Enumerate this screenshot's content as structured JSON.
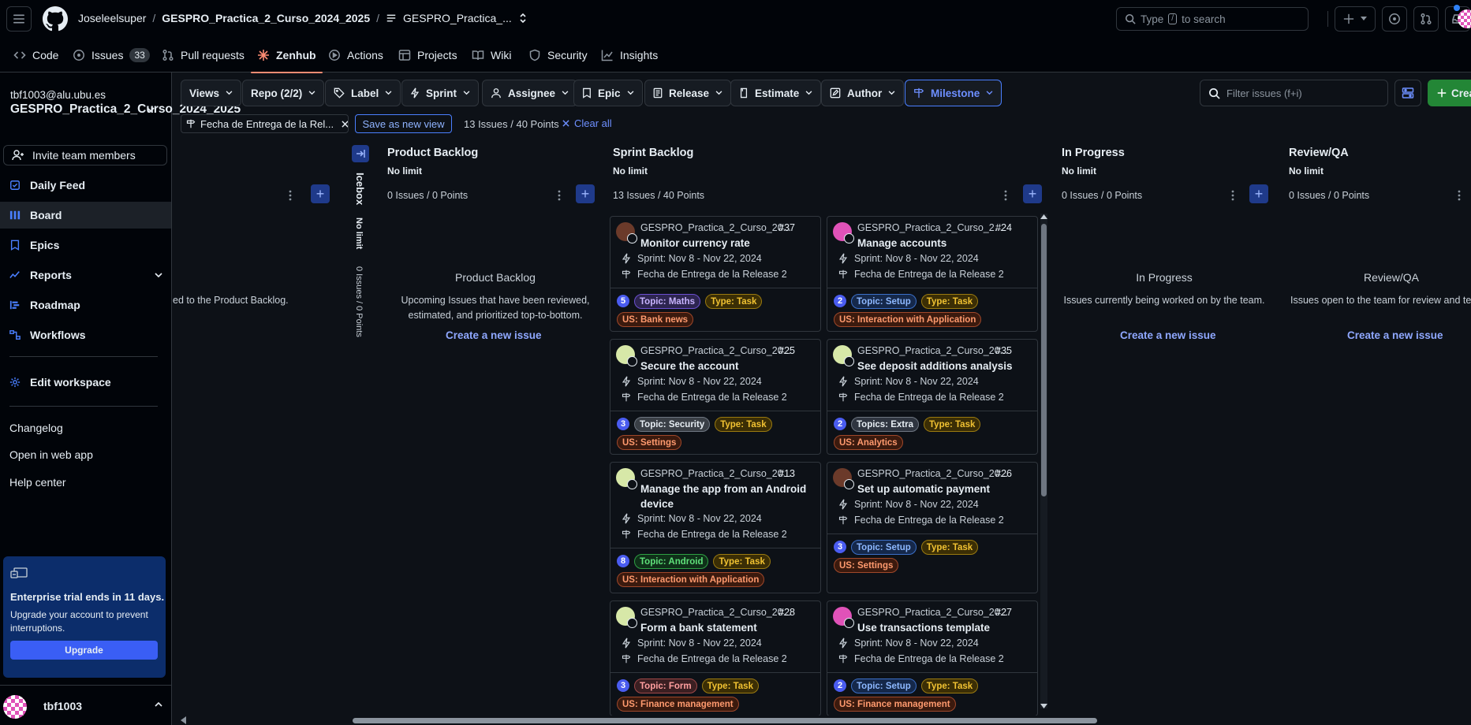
{
  "header": {
    "owner": "Joseleelsuper",
    "repo": "GESPRO_Practica_2_Curso_2024_2025",
    "workspace_short": "GESPRO_Practica_...",
    "search_pre": "Type",
    "search_key": "/",
    "search_post": "to search"
  },
  "repo_nav": {
    "code": "Code",
    "issues": "Issues",
    "issues_count": "33",
    "pulls": "Pull requests",
    "zenhub": "Zenhub",
    "actions": "Actions",
    "projects": "Projects",
    "wiki": "Wiki",
    "security": "Security",
    "insights": "Insights"
  },
  "sidebar": {
    "email": "tbf1003@alu.ubu.es",
    "workspace": "GESPRO_Practica_2_Curso_2024_2025",
    "invite": "Invite team members",
    "items": [
      "Daily Feed",
      "Board",
      "Epics",
      "Reports",
      "Roadmap",
      "Workflows"
    ],
    "edit_workspace": "Edit workspace",
    "links": [
      "Changelog",
      "Open in web app",
      "Help center"
    ],
    "trial_title": "Enterprise trial ends in 11 days.",
    "trial_body": "Upgrade your account to prevent interruptions.",
    "upgrade": "Upgrade",
    "username": "tbf1003"
  },
  "filters": {
    "buttons": [
      "Views",
      "Repo (2/2)",
      "Label",
      "Sprint",
      "Assignee",
      "Epic",
      "Release",
      "Estimate",
      "Author",
      "Milestone"
    ],
    "filter_placeholder": "Filter issues (f+i)",
    "create": "Crea",
    "chip": "Fecha de Entrega de la Rel...",
    "save_view": "Save as new view",
    "summary": "13 Issues / 40 Points",
    "clear_all": "Clear all"
  },
  "board": {
    "left_partial_text": "ed to the Product Backlog.",
    "icebox": {
      "name": "Icebox",
      "limit": "No limit",
      "count": "0 Issues / 0 Points"
    },
    "columns": [
      {
        "name": "Product Backlog",
        "limit": "No limit",
        "count": "0 Issues / 0 Points",
        "empty_title": "Product Backlog",
        "empty_desc": "Upcoming Issues that have been reviewed, estimated, and prioritized top-to-bottom.",
        "empty_link": "Create a new issue"
      },
      {
        "name": "Sprint Backlog",
        "limit": "No limit",
        "count": "13 Issues / 40 Points"
      },
      {
        "name": "In Progress",
        "limit": "No limit",
        "count": "0 Issues / 0 Points",
        "empty_title": "In Progress",
        "empty_desc": "Issues currently being worked on by the team.",
        "empty_link": "Create a new issue"
      },
      {
        "name": "Review/QA",
        "limit": "No limit",
        "count": "0 Issues / 0 Points",
        "empty_title": "Review/QA",
        "empty_desc": "Issues open to the team for review and testing. Code complete, pending feedbac",
        "empty_link": "Create a new issue"
      }
    ],
    "cards": [
      {
        "repo": "GESPRO_Practica_2_Curso_20...",
        "num": "#37",
        "title": "Monitor currency rate",
        "sprint": "Sprint: Nov 8 - Nov 22, 2024",
        "milestone": "Fecha de Entrega de la Release 2",
        "estimate": "5",
        "labels": [
          {
            "t": "Topic: Maths",
            "c": "topic-maths"
          },
          {
            "t": "Type: Task",
            "c": "type-task"
          },
          {
            "t": "US: Bank news",
            "c": "us"
          }
        ],
        "avatar": "#6b3a2a"
      },
      {
        "repo": "GESPRO_Practica_2_Curso_2...",
        "num": "#24",
        "title": "Manage accounts",
        "sprint": "Sprint: Nov 8 - Nov 22, 2024",
        "milestone": "Fecha de Entrega de la Release 2",
        "estimate": "2",
        "labels": [
          {
            "t": "Topic: Setup",
            "c": "topic-setup"
          },
          {
            "t": "Type: Task",
            "c": "type-task"
          },
          {
            "t": "US: Interaction with Application",
            "c": "us"
          }
        ],
        "avatar": "#e052b8"
      },
      {
        "repo": "GESPRO_Practica_2_Curso_20...",
        "num": "#25",
        "title": "Secure the account",
        "sprint": "Sprint: Nov 8 - Nov 22, 2024",
        "milestone": "Fecha de Entrega de la Release 2",
        "estimate": "3",
        "labels": [
          {
            "t": "Topic: Security",
            "c": "topic-security"
          },
          {
            "t": "Type: Task",
            "c": "type-task"
          },
          {
            "t": "US: Settings",
            "c": "us"
          }
        ],
        "avatar": "#d7e8a8"
      },
      {
        "repo": "GESPRO_Practica_2_Curso_20...",
        "num": "#35",
        "title": "See deposit additions analysis",
        "sprint": "Sprint: Nov 8 - Nov 22, 2024",
        "milestone": "Fecha de Entrega de la Release 2",
        "estimate": "2",
        "labels": [
          {
            "t": "Topics: Extra",
            "c": "topics-extra"
          },
          {
            "t": "Type: Task",
            "c": "type-task"
          },
          {
            "t": "US: Analytics",
            "c": "us"
          }
        ],
        "avatar": "#d7e8a8"
      },
      {
        "repo": "GESPRO_Practica_2_Curso_20...",
        "num": "#13",
        "title": "Manage the app from an Android device",
        "sprint": "Sprint: Nov 8 - Nov 22, 2024",
        "milestone": "Fecha de Entrega de la Release 2",
        "estimate": "8",
        "labels": [
          {
            "t": "Topic: Android",
            "c": "topic-android"
          },
          {
            "t": "Type: Task",
            "c": "type-task"
          },
          {
            "t": "US: Interaction with Application",
            "c": "us"
          }
        ],
        "avatar": "#d7e8a8"
      },
      {
        "repo": "GESPRO_Practica_2_Curso_20...",
        "num": "#26",
        "title": "Set up automatic payment",
        "sprint": "Sprint: Nov 8 - Nov 22, 2024",
        "milestone": "Fecha de Entrega de la Release 2",
        "estimate": "3",
        "labels": [
          {
            "t": "Topic: Setup",
            "c": "topic-setup"
          },
          {
            "t": "Type: Task",
            "c": "type-task"
          },
          {
            "t": "US: Settings",
            "c": "us"
          }
        ],
        "avatar": "#6b3a2a"
      },
      {
        "repo": "GESPRO_Practica_2_Curso_20...",
        "num": "#28",
        "title": "Form a bank statement",
        "sprint": "Sprint: Nov 8 - Nov 22, 2024",
        "milestone": "Fecha de Entrega de la Release 2",
        "estimate": "3",
        "labels": [
          {
            "t": "Topic: Form",
            "c": "topic-form"
          },
          {
            "t": "Type: Task",
            "c": "type-task"
          },
          {
            "t": "US: Finance management",
            "c": "us"
          }
        ],
        "avatar": "#d7e8a8"
      },
      {
        "repo": "GESPRO_Practica_2_Curso_20...",
        "num": "#27",
        "title": "Use transactions template",
        "sprint": "Sprint: Nov 8 - Nov 22, 2024",
        "milestone": "Fecha de Entrega de la Release 2",
        "estimate": "2",
        "labels": [
          {
            "t": "Topic: Setup",
            "c": "topic-setup"
          },
          {
            "t": "Type: Task",
            "c": "type-task"
          },
          {
            "t": "US: Finance management",
            "c": "us"
          }
        ],
        "avatar": "#e052b8"
      }
    ]
  },
  "colors": {
    "accent": "#4a7fff",
    "create_green": "#238636",
    "zenhub_tab_underline": "#fd8c73"
  }
}
